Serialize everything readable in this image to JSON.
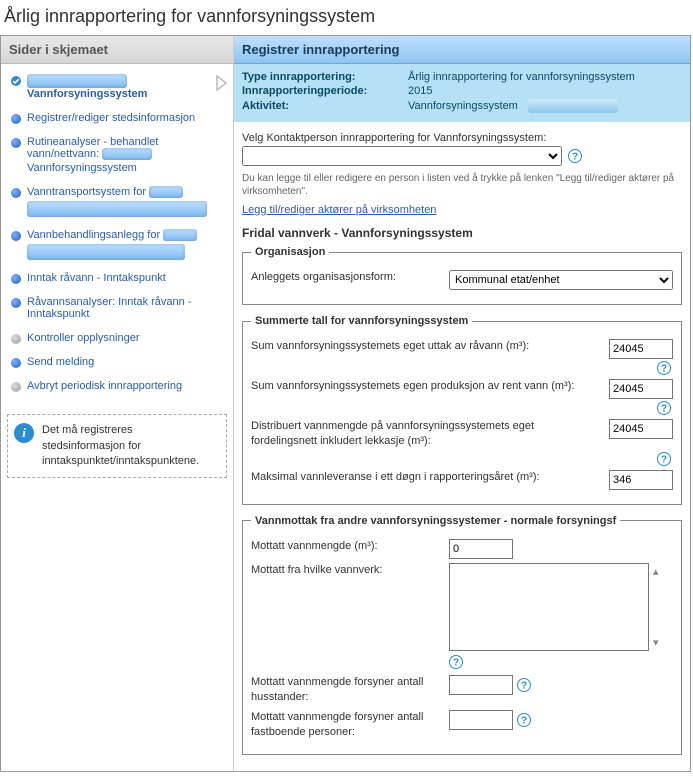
{
  "page_title": "Årlig innrapportering for vannforsyningssystem",
  "sidebar": {
    "header": "Sider i skjemaet",
    "items": [
      {
        "label": "Vannforsyningssystem",
        "kind": "check",
        "current": true,
        "hasArrow": true
      },
      {
        "label": "Registrer/rediger stedsinformasjon",
        "kind": "blue"
      },
      {
        "label": "Rutineanalyser - behandlet vann/nettvann:",
        "suffix": "Vannforsyningssystem",
        "kind": "blue",
        "redactAfterLabel": true
      },
      {
        "label": "Vanntransportsystem for",
        "kind": "blue",
        "redactBig": true
      },
      {
        "label": "Vannbehandlingsanlegg for",
        "kind": "blue",
        "redactBig": true
      },
      {
        "label": "Inntak råvann - Inntakspunkt",
        "kind": "blue"
      },
      {
        "label": "Råvannsanalyser: Inntak råvann - Inntakspunkt",
        "kind": "blue"
      },
      {
        "label": "Kontroller opplysninger",
        "kind": "grey"
      },
      {
        "label": "Send melding",
        "kind": "blue"
      },
      {
        "label": "Avbryt periodisk innrapportering",
        "kind": "grey"
      }
    ],
    "info": "Det må registreres stedsinformasjon for inntakspunktet/inntakspunktene."
  },
  "main": {
    "header": "Registrer innrapportering",
    "meta": {
      "k1": "Type innrapportering:",
      "v1": "Årlig innrapportering for vannforsyningssystem",
      "k2": "Innrapporteringperiode:",
      "v2": "2015",
      "k3": "Aktivitet:",
      "v3": "Vannforsyningssystem"
    },
    "contact_label": "Velg Kontaktperson innrapportering for Vannforsyningssystem:",
    "contact_value": "",
    "hint": "Du kan legge til eller redigere en person i listen ved å trykke på lenken \"Legg til/rediger aktører på virksomheten\".",
    "hint_link": "Legg til/rediger aktører på virksomheten",
    "subhead": "Fridal vannverk - Vannforsyningssystem",
    "org": {
      "legend": "Organisasjon",
      "label": "Anleggets organisasjonsform:",
      "value": "Kommunal etat/enhet"
    },
    "sum": {
      "legend": "Summerte tall for vannforsyningssystem",
      "r1": "Sum vannforsyningssystemets eget uttak av råvann (m³):",
      "v1": "24045",
      "r2": "Sum vannforsyningssystemets egen produksjon av rent vann (m³):",
      "v2": "24045",
      "r3": "Distribuert vannmengde på vannforsyningssystemets eget fordelingsnett inkludert lekkasje (m³):",
      "v3": "24045",
      "r4": "Maksimal vannleveranse i ett døgn i rapporteringsåret (m³):",
      "v4": "346"
    },
    "mottak": {
      "legend": "Vannmottak fra andre vannforsyningssystemer - normale forsyningsf",
      "r1": "Mottatt vannmengde (m³):",
      "v1": "0",
      "r2": "Mottatt fra hvilke vannverk:",
      "v2": "",
      "r3": "Mottatt vannmengde forsyner antall husstander:",
      "v3": "",
      "r4": "Mottatt vannmengde forsyner antall fastboende personer:",
      "v4": ""
    }
  }
}
